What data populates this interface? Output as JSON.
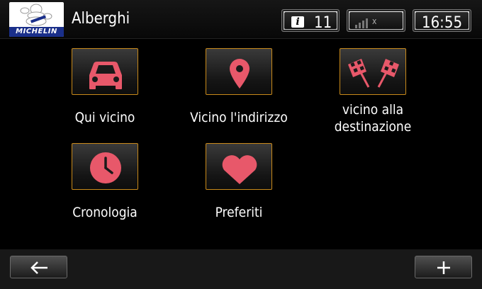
{
  "header": {
    "brand_logo_text": "MICHELIN",
    "title": "Alberghi",
    "info_count": "11",
    "signal_label": "x",
    "time": "16:55"
  },
  "menu": {
    "items": [
      {
        "label": "Qui vicino",
        "icon": "car-icon"
      },
      {
        "label": "Vicino l'indirizzo",
        "icon": "map-pin-icon"
      },
      {
        "label_line1": "vicino alla",
        "label_line2": "destinazione",
        "icon": "checkered-flags-icon"
      },
      {
        "label": "Cronologia",
        "icon": "clock-icon"
      },
      {
        "label": "Preferiti",
        "icon": "heart-icon"
      }
    ]
  },
  "footer": {
    "back_icon": "back-arrow-icon",
    "add_icon": "plus-icon"
  },
  "colors": {
    "icon_pink": "#e8586a",
    "tile_border": "#c98a1b",
    "background": "#000000"
  }
}
